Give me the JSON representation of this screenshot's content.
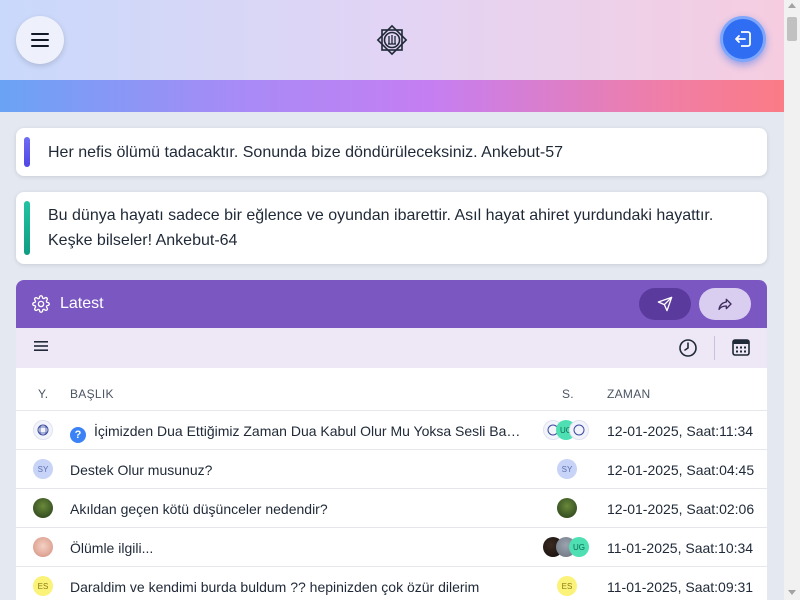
{
  "header": {
    "menu_icon": "hamburger-icon",
    "logo_icon": "mosque-star-logo",
    "logout_icon": "logout-icon",
    "logout_color": "#2f6ef3"
  },
  "quotes": [
    {
      "text": "Her nefis ölümü tadacaktır. Sonunda bize döndürüleceksiniz. Ankebut-57",
      "accent": "#5b57ef"
    },
    {
      "text": "Bu dünya hayatı sadece bir eğlence ve oyundan ibarettir. Asıl hayat ahiret yurdundaki hayattır. Keşke bilseler! Ankebut-64",
      "accent": "#17b394"
    }
  ],
  "panel": {
    "title": "Latest",
    "title_icon": "gear-icon",
    "header_color": "#7b57c2",
    "send_icon": "send-icon",
    "share_icon": "share-icon",
    "toolbar_icons": [
      "list-icon",
      "clock-icon",
      "calendar-icon"
    ]
  },
  "table": {
    "columns": [
      "Y.",
      "BAŞLIK",
      "S.",
      "ZAMAN"
    ],
    "rows": [
      {
        "author": "logo",
        "title": "İçimizden Dua Ettiğimiz Zaman Dua Kabul Olur Mu Yoksa Sesli Bağırarak Mı Kabul Olur?",
        "has_question_icon": true,
        "participants": [
          "logo",
          "UG",
          "logo"
        ],
        "time": "12-01-2025, Saat:11:34"
      },
      {
        "author": "SY",
        "title": "Destek Olur musunuz?",
        "participants": [
          "SY"
        ],
        "time": "12-01-2025, Saat:04:45"
      },
      {
        "author": "tree",
        "title": "Akıldan geçen kötü düşünceler nedendir?",
        "participants": [
          "tree"
        ],
        "time": "12-01-2025, Saat:02:06"
      },
      {
        "author": "girl",
        "title": "Ölümle ilgili...",
        "participants": [
          "dark",
          "gray",
          "UG"
        ],
        "time": "11-01-2025, Saat:10:34"
      },
      {
        "author": "ES",
        "title": "Daraldim ve kendimi burda buldum ?? hepinizden çok özür dilerim",
        "participants": [
          "ES"
        ],
        "time": "11-01-2025, Saat:09:31"
      }
    ]
  }
}
